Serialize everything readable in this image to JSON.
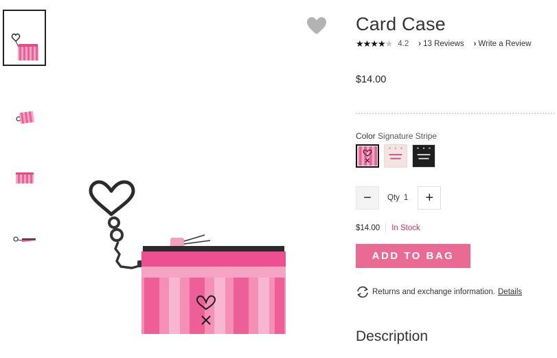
{
  "thumbnails": [
    {
      "name": "Card case front with heart keyring",
      "active": true
    },
    {
      "name": "Card case angled"
    },
    {
      "name": "Card case closed"
    },
    {
      "name": "Card case side view"
    }
  ],
  "product": {
    "title": "Card Case",
    "rating_value": "4.2",
    "reviews_link": "13 Reviews",
    "write_review_link": "Write a Review",
    "price": "$14.00"
  },
  "color": {
    "label": "Color",
    "selected": "Signature Stripe",
    "swatches": [
      "Signature Stripe",
      "Blush Logo",
      "Black Logo"
    ]
  },
  "quantity": {
    "label": "Qty",
    "value": "1",
    "minus": "−",
    "plus": "+"
  },
  "stock": {
    "price": "$14.00",
    "status": "In Stock"
  },
  "actions": {
    "add_to_bag": "ADD TO BAG"
  },
  "returns": {
    "text": "Returns and exchange information.",
    "details_link": "Details"
  },
  "sections": {
    "description_heading": "Description"
  },
  "colors": {
    "accent_pink": "#e96a93",
    "stock_pink": "#d22c6e",
    "stripe_pink": "#f06fa5"
  },
  "icons": {
    "wishlist": "heart-icon",
    "returns": "returns-icon"
  }
}
